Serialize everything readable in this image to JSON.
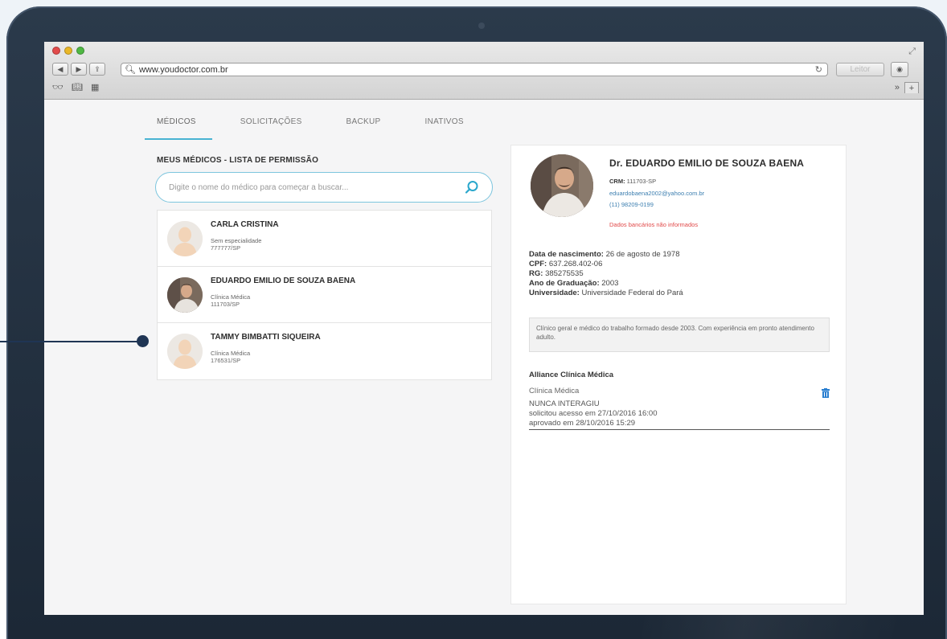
{
  "browser": {
    "url": "www.youdoctor.com.br",
    "reader_label": "Leitor"
  },
  "tabs": [
    {
      "label": "MÉDICOS",
      "active": true
    },
    {
      "label": "SOLICITAÇÕES",
      "active": false
    },
    {
      "label": "BACKUP",
      "active": false
    },
    {
      "label": "INATIVOS",
      "active": false
    }
  ],
  "list": {
    "title": "MEUS MÉDICOS - LISTA DE PERMISSÃO",
    "search_placeholder": "Digite o nome do médico para começar a buscar...",
    "doctors": [
      {
        "name": "CARLA CRISTINA",
        "specialty": "Sem especialidade",
        "crm": "777777/SP"
      },
      {
        "name": "EDUARDO EMILIO DE SOUZA BAENA",
        "specialty": "Clínica Médica",
        "crm": "111703/SP"
      },
      {
        "name": "TAMMY BIMBATTI SIQUEIRA",
        "specialty": "Clínica Médica",
        "crm": "176531/SP"
      }
    ]
  },
  "detail": {
    "name": "Dr. EDUARDO EMILIO DE SOUZA BAENA",
    "crm_label": "CRM:",
    "crm_value": "111703-SP",
    "email": "eduardobaena2002@yahoo.com.br",
    "phone": "(11) 98209-0199",
    "bank_notice": "Dados bancários não informados",
    "birth_label": "Data de nascimento:",
    "birth_value": "26 de agosto de 1978",
    "cpf_label": "CPF:",
    "cpf_value": "637.268.402-06",
    "rg_label": "RG:",
    "rg_value": "385275535",
    "grad_label": "Ano de Graduação:",
    "grad_value": "2003",
    "univ_label": "Universidade:",
    "univ_value": "Universidade Federal do Pará",
    "bio": "Clínico geral e médico do trabalho formado desde 2003. Com experiência em pronto atendimento adulto.",
    "clinic": {
      "name": "Alliance Clínica Médica",
      "specialty": "Clínica Médica",
      "status": "NUNCA INTERAGIU",
      "requested": "solicitou acesso em 27/10/2016 16:00",
      "approved": "aprovado em 28/10/2016 15:29"
    }
  }
}
